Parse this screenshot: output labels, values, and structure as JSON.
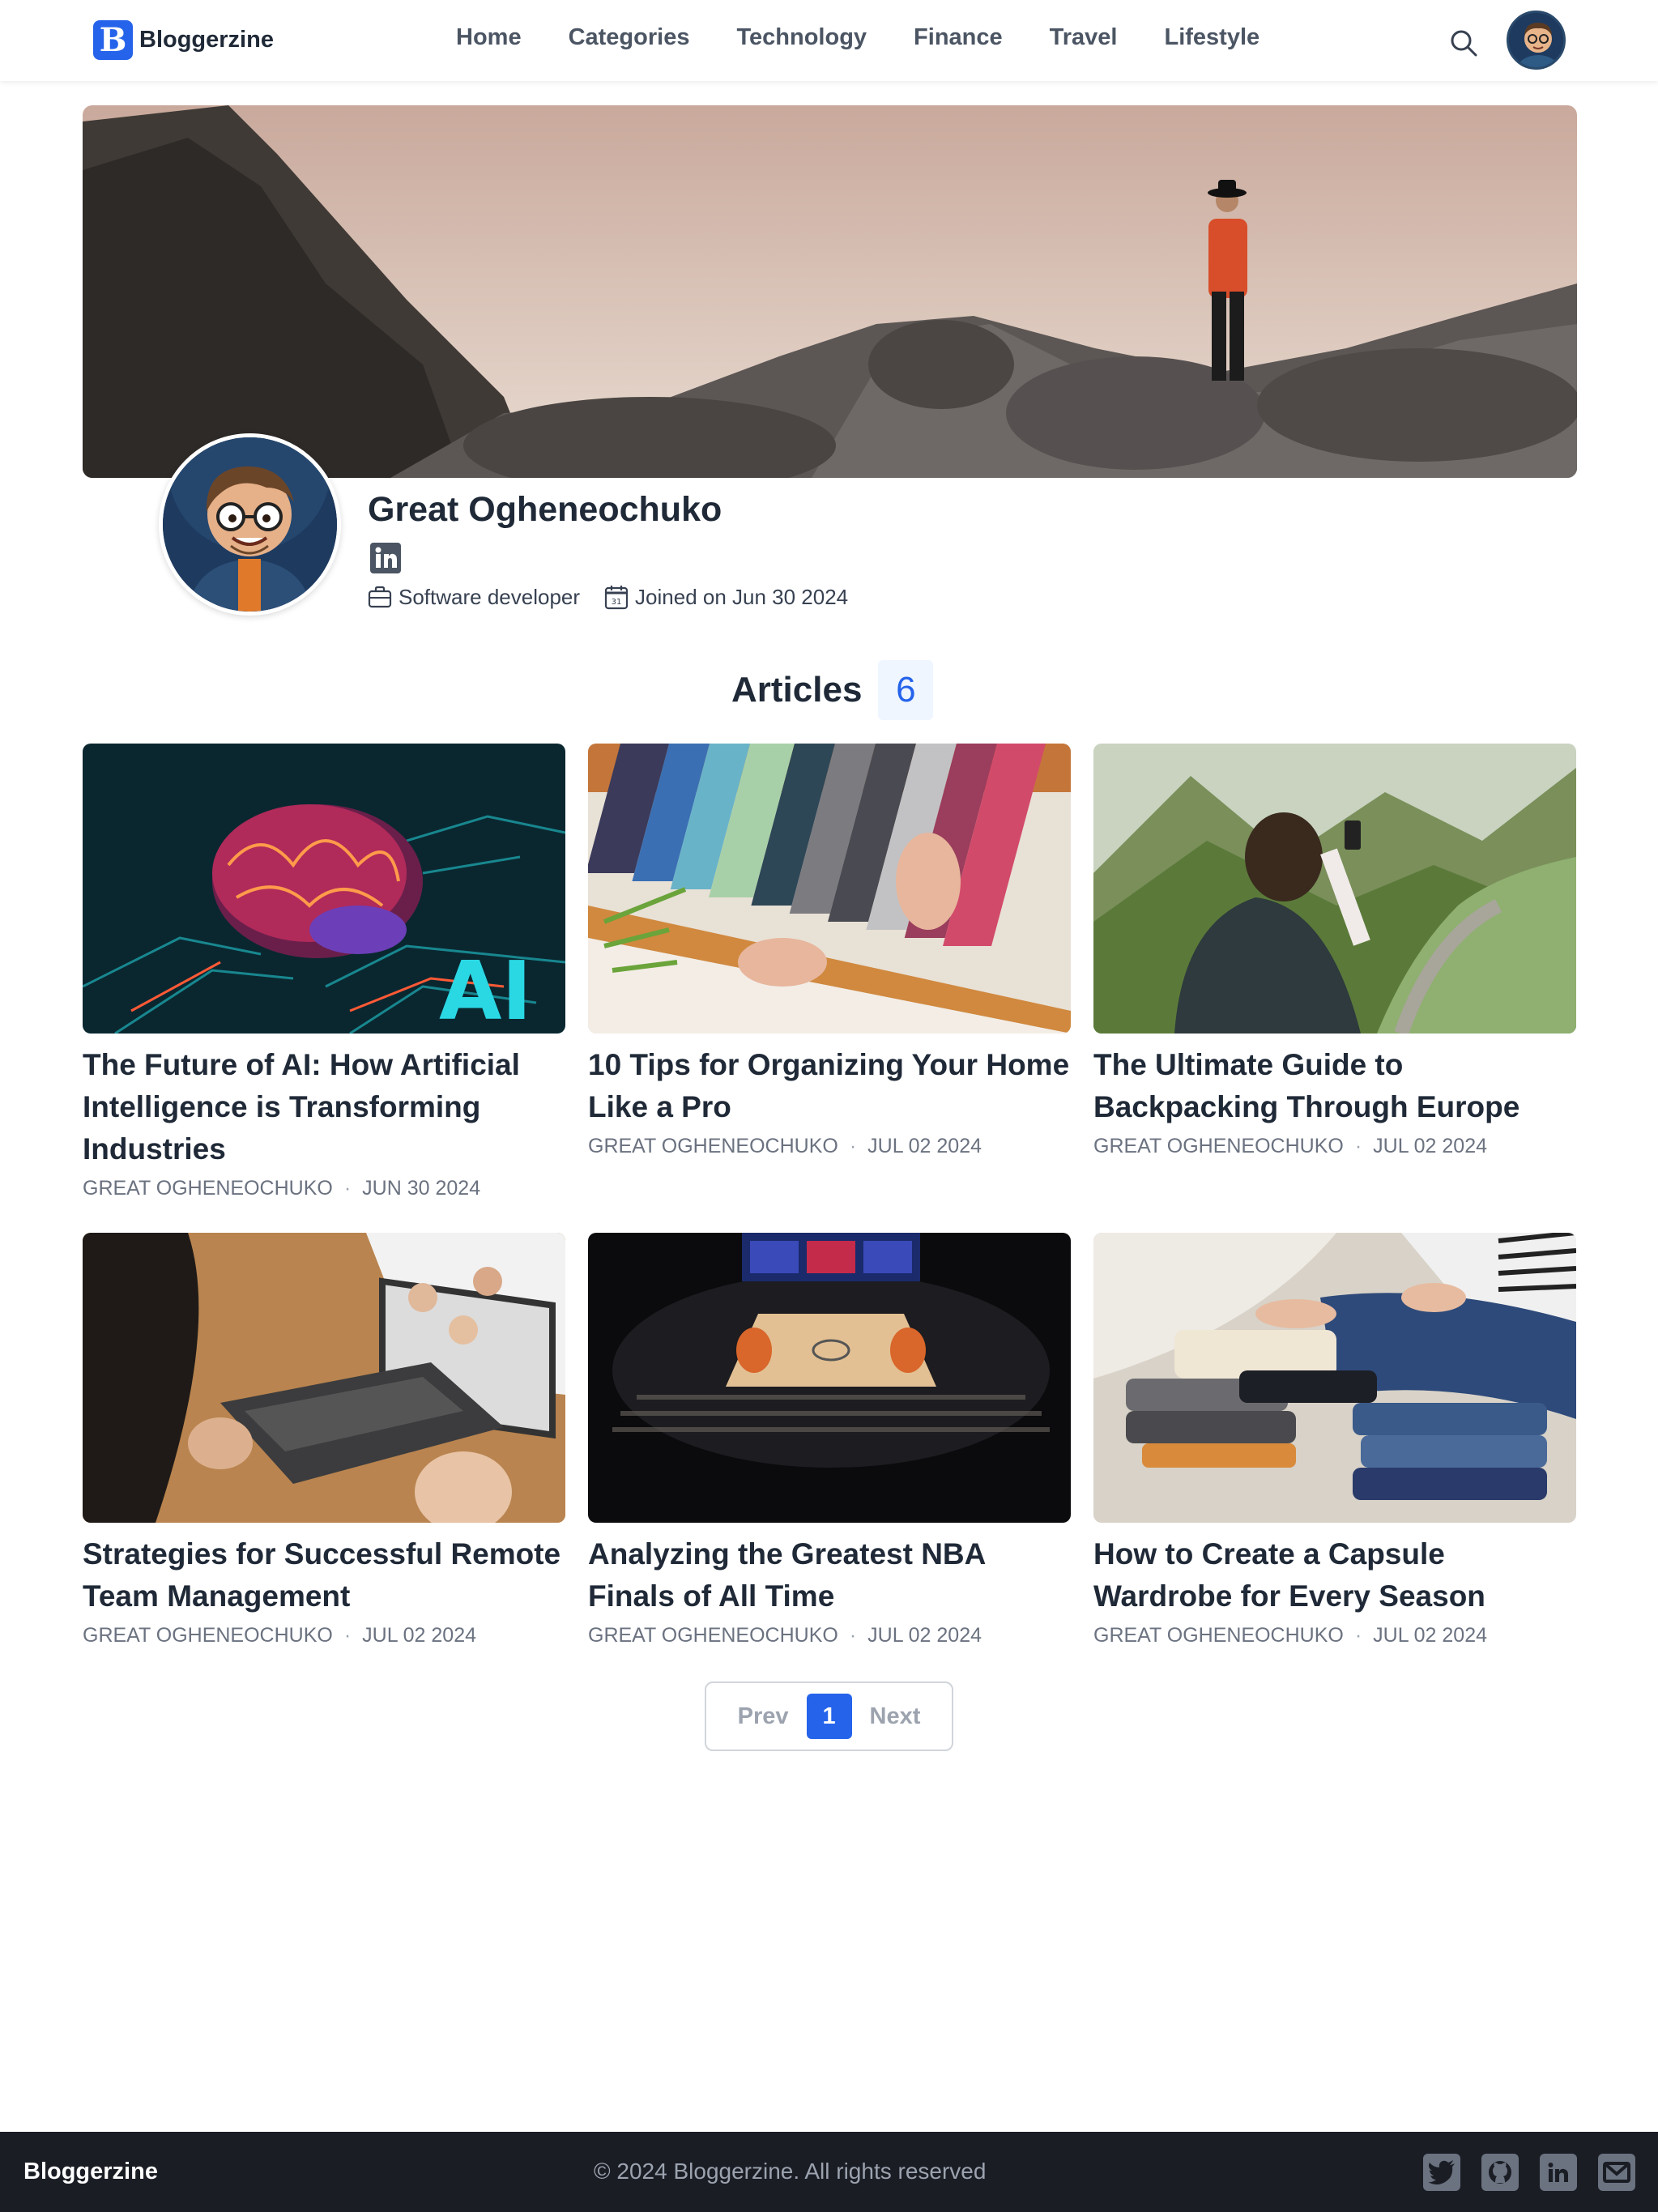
{
  "header": {
    "logo_text": "Bloggerzine",
    "logo_letter": "B",
    "nav": [
      {
        "label": "Home"
      },
      {
        "label": "Categories"
      },
      {
        "label": "Technology"
      },
      {
        "label": "Finance"
      },
      {
        "label": "Travel"
      },
      {
        "label": "Lifestyle"
      }
    ],
    "search_icon": "search-icon"
  },
  "profile": {
    "name": "Great Ogheneochuko",
    "occupation": "Software developer",
    "joined": "Joined on Jun 30 2024",
    "social": "linkedin-icon"
  },
  "articles": {
    "title": "Articles",
    "count": "6",
    "items": [
      {
        "title": "The Future of AI: How Artificial Intelligence is Transforming Industries",
        "author": "GREAT OGHENEOCHUKO",
        "date": "JUN 30 2024"
      },
      {
        "title": "10 Tips for Organizing Your Home Like a Pro",
        "author": "GREAT OGHENEOCHUKO",
        "date": "JUL 02 2024"
      },
      {
        "title": "The Ultimate Guide to Backpacking Through Europe",
        "author": "GREAT OGHENEOCHUKO",
        "date": "JUL 02 2024"
      },
      {
        "title": "Strategies for Successful Remote Team Management",
        "author": "GREAT OGHENEOCHUKO",
        "date": "JUL 02 2024"
      },
      {
        "title": "Analyzing the Greatest NBA Finals of All Time",
        "author": "GREAT OGHENEOCHUKO",
        "date": "JUL 02 2024"
      },
      {
        "title": "How to Create a Capsule Wardrobe for Every Season",
        "author": "GREAT OGHENEOCHUKO",
        "date": "JUL 02 2024"
      }
    ]
  },
  "pagination": {
    "prev": "Prev",
    "current": "1",
    "next": "Next"
  },
  "footer": {
    "brand": "Bloggerzine",
    "copyright": "© 2024 Bloggerzine. All rights reserved",
    "social": [
      "twitter-icon",
      "github-icon",
      "linkedin-icon",
      "mail-icon"
    ]
  },
  "colors": {
    "accent": "#2563eb",
    "footer_bg": "#1a1d24"
  }
}
